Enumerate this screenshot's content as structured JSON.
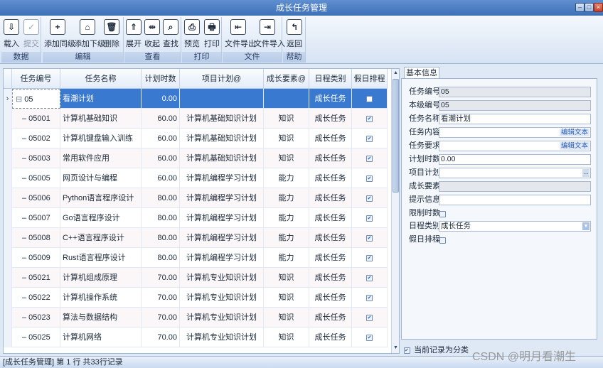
{
  "window": {
    "title": "成长任务管理"
  },
  "ribbon": {
    "groups": [
      {
        "label": "数据",
        "buttons": [
          {
            "label": "载入",
            "icon": "load-icon",
            "glyph": "⇩"
          },
          {
            "label": "提交",
            "icon": "submit-icon",
            "glyph": "✓",
            "disabled": true
          }
        ]
      },
      {
        "label": "编辑",
        "buttons": [
          {
            "label": "添加同级",
            "icon": "add-sibling-icon",
            "glyph": "+"
          },
          {
            "label": "添加下级",
            "icon": "add-child-icon",
            "glyph": "⌂"
          },
          {
            "label": "删除",
            "icon": "delete-icon",
            "glyph": "🗑"
          }
        ]
      },
      {
        "label": "查看",
        "buttons": [
          {
            "label": "展开",
            "icon": "expand-icon",
            "glyph": "⇑"
          },
          {
            "label": "收起",
            "icon": "collapse-icon",
            "glyph": "⇹"
          },
          {
            "label": "查找",
            "icon": "find-icon",
            "glyph": "⌕"
          }
        ]
      },
      {
        "label": "打印",
        "buttons": [
          {
            "label": "预览",
            "icon": "preview-icon",
            "glyph": "⎙"
          },
          {
            "label": "打印",
            "icon": "print-icon",
            "glyph": "🖶"
          }
        ]
      },
      {
        "label": "文件",
        "buttons": [
          {
            "label": "文件导出",
            "icon": "export-icon",
            "glyph": "⇤"
          },
          {
            "label": "文件导入",
            "icon": "import-icon",
            "glyph": "⇥"
          }
        ]
      },
      {
        "label": "帮助",
        "buttons": [
          {
            "label": "返回",
            "icon": "return-icon",
            "glyph": "↰"
          }
        ]
      }
    ]
  },
  "grid": {
    "columns": [
      "任务编号",
      "任务名称",
      "计划时数",
      "项目计划@",
      "成长要素@",
      "日程类别",
      "假日排程"
    ],
    "rows": [
      {
        "id": "05",
        "name": "看潮计划",
        "hours": "0.00",
        "plan": "",
        "element": "",
        "category": "成长任务",
        "holiday": true,
        "selected": true,
        "level": 0
      },
      {
        "id": "05001",
        "name": "计算机基础知识",
        "hours": "60.00",
        "plan": "计算机基础知识计划",
        "element": "知识",
        "category": "成长任务",
        "holiday": true,
        "level": 1
      },
      {
        "id": "05002",
        "name": "计算机键盘输入训练",
        "hours": "60.00",
        "plan": "计算机基础知识计划",
        "element": "知识",
        "category": "成长任务",
        "holiday": true,
        "level": 1
      },
      {
        "id": "05003",
        "name": "常用软件应用",
        "hours": "60.00",
        "plan": "计算机基础知识计划",
        "element": "知识",
        "category": "成长任务",
        "holiday": true,
        "level": 1
      },
      {
        "id": "05005",
        "name": "网页设计与编程",
        "hours": "60.00",
        "plan": "计算机编程学习计划",
        "element": "能力",
        "category": "成长任务",
        "holiday": true,
        "level": 1
      },
      {
        "id": "05006",
        "name": "Python语言程序设计",
        "hours": "80.00",
        "plan": "计算机编程学习计划",
        "element": "能力",
        "category": "成长任务",
        "holiday": true,
        "level": 1
      },
      {
        "id": "05007",
        "name": "Go语言程序设计",
        "hours": "80.00",
        "plan": "计算机编程学习计划",
        "element": "能力",
        "category": "成长任务",
        "holiday": true,
        "level": 1
      },
      {
        "id": "05008",
        "name": "C++语言程序设计",
        "hours": "80.00",
        "plan": "计算机编程学习计划",
        "element": "能力",
        "category": "成长任务",
        "holiday": true,
        "level": 1
      },
      {
        "id": "05009",
        "name": "Rust语言程序设计",
        "hours": "80.00",
        "plan": "计算机编程学习计划",
        "element": "能力",
        "category": "成长任务",
        "holiday": true,
        "level": 1
      },
      {
        "id": "05021",
        "name": "计算机组成原理",
        "hours": "70.00",
        "plan": "计算机专业知识计划",
        "element": "知识",
        "category": "成长任务",
        "holiday": true,
        "level": 1
      },
      {
        "id": "05022",
        "name": "计算机操作系统",
        "hours": "70.00",
        "plan": "计算机专业知识计划",
        "element": "知识",
        "category": "成长任务",
        "holiday": true,
        "level": 1
      },
      {
        "id": "05023",
        "name": "算法与数据结构",
        "hours": "70.00",
        "plan": "计算机专业知识计划",
        "element": "知识",
        "category": "成长任务",
        "holiday": true,
        "level": 1
      },
      {
        "id": "05025",
        "name": "计算机网络",
        "hours": "70.00",
        "plan": "计算机专业知识计划",
        "element": "知识",
        "category": "成长任务",
        "holiday": true,
        "level": 1
      }
    ]
  },
  "panel": {
    "tab": "基本信息",
    "fields": {
      "task_id": {
        "label": "任务编号",
        "value": "05"
      },
      "level_id": {
        "label": "本级编号",
        "value": "05"
      },
      "task_name": {
        "label": "任务名称",
        "value": "看潮计划"
      },
      "task_content": {
        "label": "任务内容",
        "value": "",
        "button": "编辑文本"
      },
      "task_req": {
        "label": "任务要求",
        "value": "",
        "button": "编辑文本"
      },
      "plan_hours": {
        "label": "计划时数",
        "value": "0.00"
      },
      "project_plan": {
        "label": "项目计划",
        "value": "",
        "button": "..."
      },
      "growth_element": {
        "label": "成长要素",
        "value": ""
      },
      "hint": {
        "label": "提示信息",
        "value": ""
      },
      "limit_hours": {
        "label": "限制时数"
      },
      "schedule_category": {
        "label": "日程类别",
        "value": "成长任务"
      },
      "holiday": {
        "label": "假日排程"
      }
    },
    "classify_checkbox": {
      "label": "当前记录为分类",
      "checked": true
    }
  },
  "status": {
    "text": "[成长任务管理] 第 1 行 共33行记录"
  },
  "watermark": "CSDN @明月看潮生"
}
